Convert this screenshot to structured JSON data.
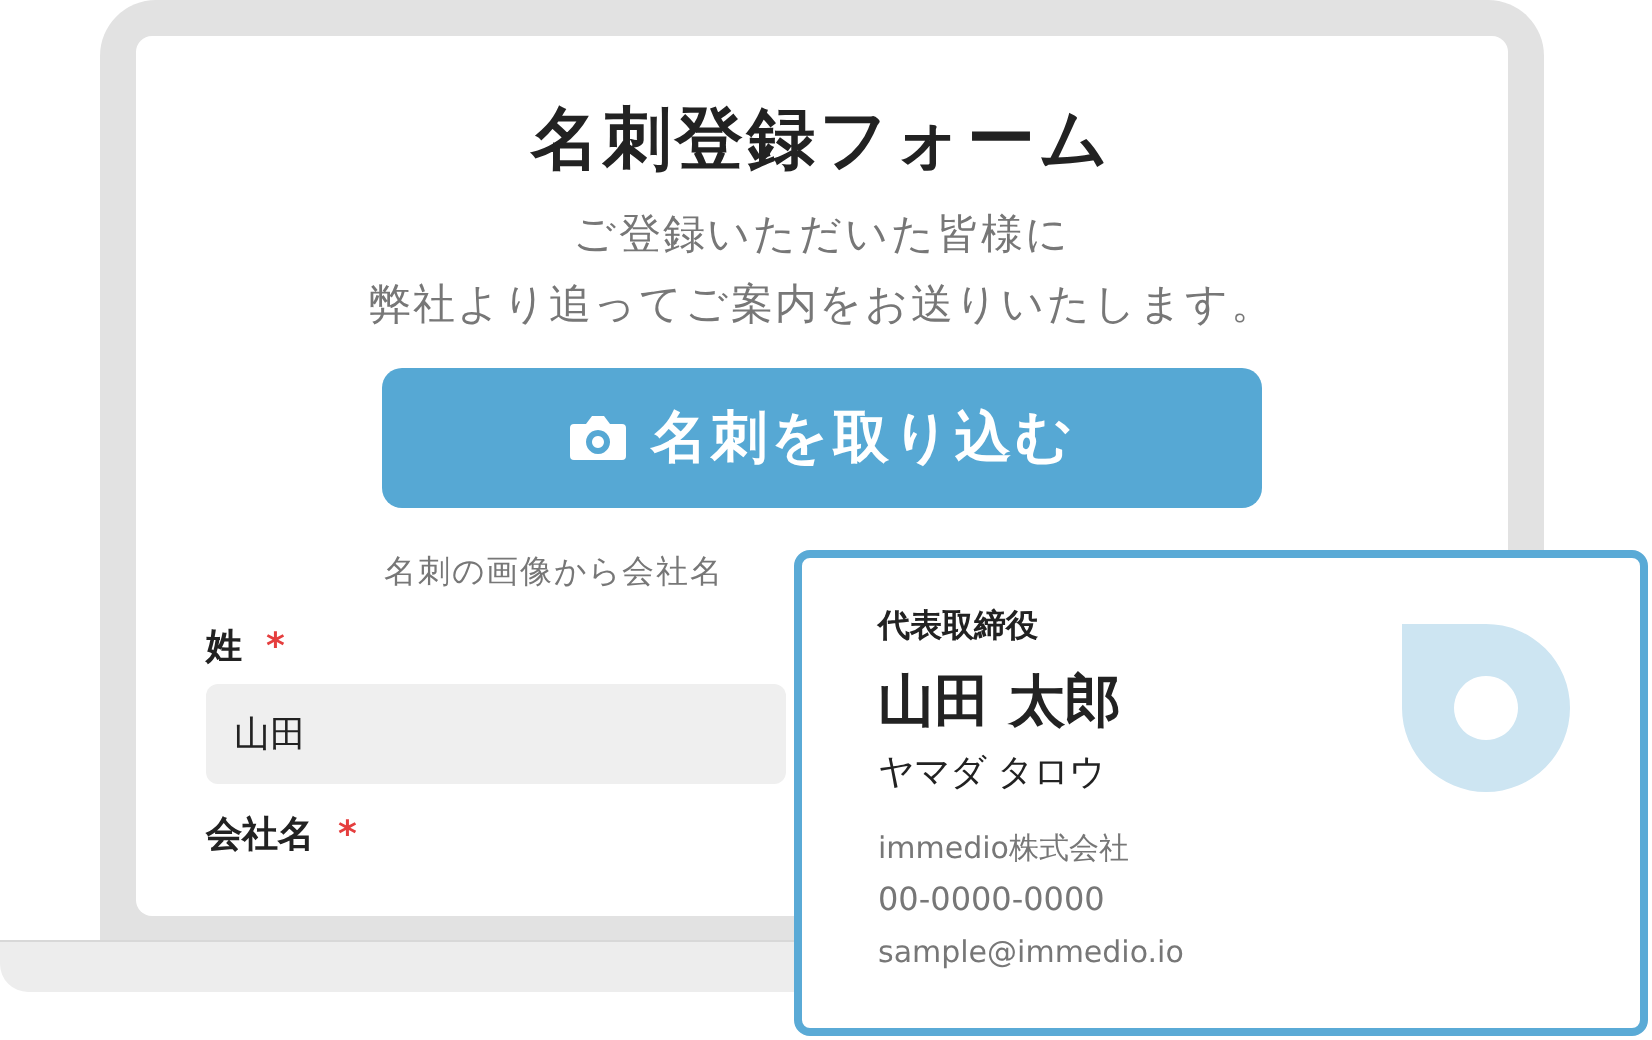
{
  "form": {
    "title": "名刺登録フォーム",
    "description_lines": [
      "ご登録いただいた皆様に",
      "弊社より追ってご案内をお送りいたします。"
    ],
    "scan_button": {
      "label": "名刺を取り込む"
    },
    "hint": "名刺の画像から会社名",
    "fields": [
      {
        "label": "姓",
        "required_mark": "*",
        "value": "山田"
      },
      {
        "label": "会社名",
        "required_mark": "*"
      }
    ]
  },
  "business_card": {
    "title": "代表取締役",
    "name": "山田 太郎",
    "kana": "ヤマダ タロウ",
    "company": "immedio株式会社",
    "phone": "00-0000-0000",
    "email": "sample@immedio.io"
  }
}
